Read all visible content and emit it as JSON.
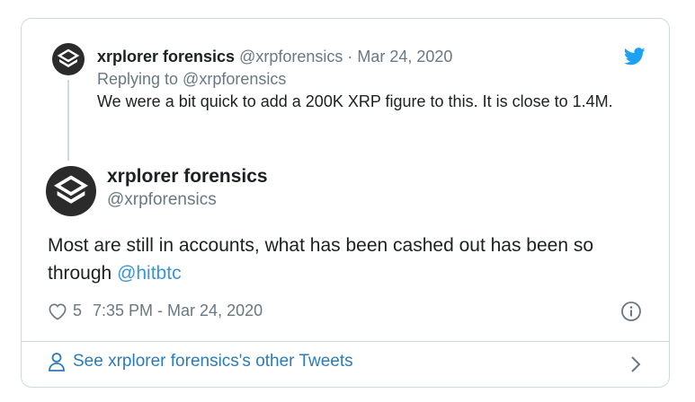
{
  "quoted_tweet": {
    "author_name": "xrplorer forensics",
    "handle": "@xrpforensics",
    "separator": "·",
    "date": "Mar 24, 2020",
    "replying_to": "Replying to @xrpforensics",
    "text": "We were a bit quick to add a 200K XRP figure to this. It is close to 1.4M."
  },
  "main_tweet": {
    "author_name": "xrplorer forensics",
    "handle": "@xrpforensics",
    "text_before": "Most are still in accounts, what has been cashed out has been so through ",
    "mention": "@hitbtc",
    "likes": "5",
    "timestamp": "7:35 PM - Mar 24, 2020"
  },
  "footer": {
    "see_more_label": "See xrplorer forensics's other Tweets"
  },
  "colors": {
    "accent": "#1da1f2",
    "link": "#3b94d9",
    "muted": "#697882",
    "border": "#cfd9de"
  },
  "icons": [
    "xrplorer-logo-icon",
    "twitter-bird-icon",
    "heart-icon",
    "info-icon",
    "person-icon",
    "chevron-right-icon"
  ]
}
